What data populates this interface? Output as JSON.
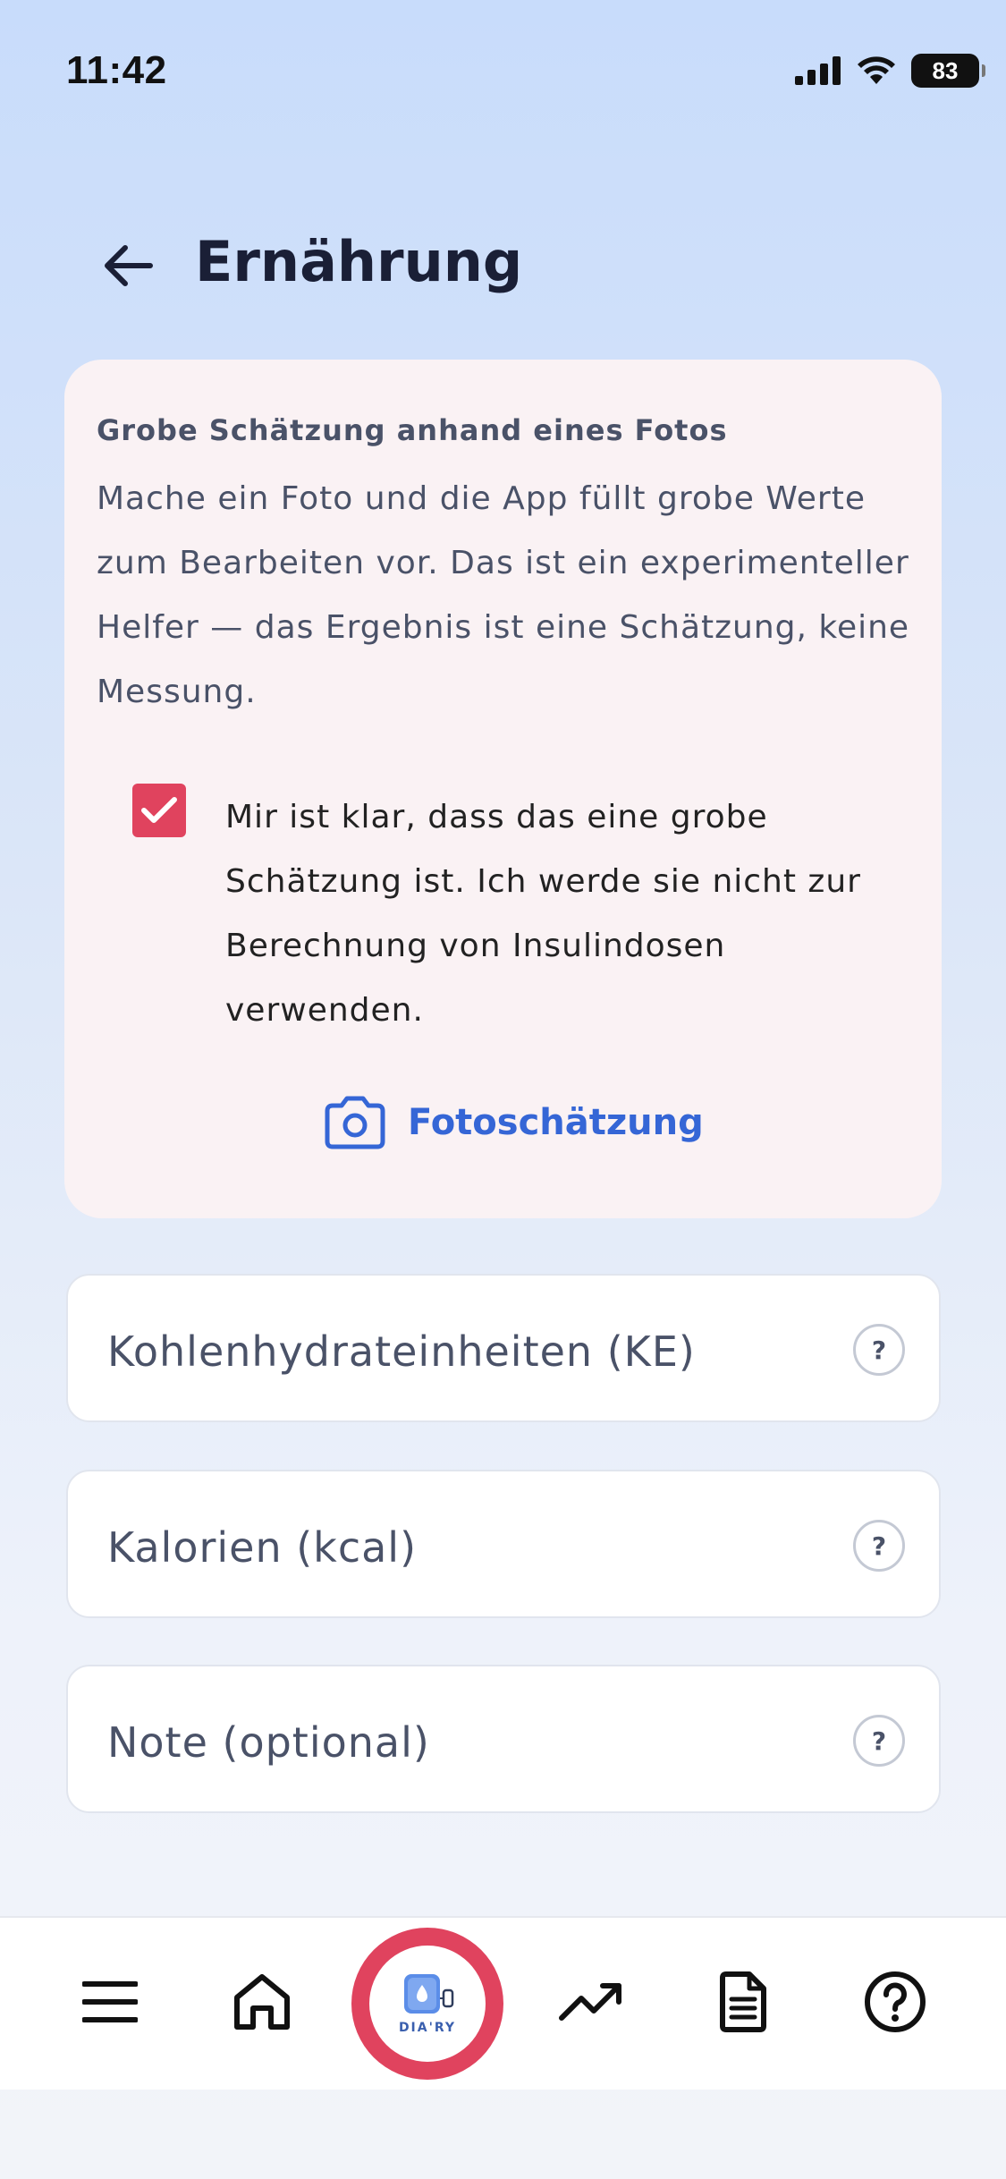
{
  "status_bar": {
    "time": "11:42",
    "battery": "83"
  },
  "header": {
    "title": "Ernährung",
    "back_icon": "arrow-left-icon"
  },
  "photo_card": {
    "title": "Grobe Schätzung anhand eines Fotos",
    "description": "Mache ein Foto und die App füllt grobe Werte zum Bearbeiten vor. Das ist ein experimenteller Helfer — das Ergebnis ist eine Schätzung, keine Messung.",
    "consent_checked": true,
    "consent_text": "Mir ist klar, dass das eine grobe Schätzung ist. Ich werde sie nicht zur Berechnung von Insulindosen verwenden.",
    "photo_button_label": "Fotoschätzung",
    "photo_button_icon": "camera-icon"
  },
  "fields": [
    {
      "label": "Kohlenhydrateinheiten (KE)",
      "help": "?"
    },
    {
      "label": "Kalorien (kcal)",
      "help": "?"
    },
    {
      "label": "Note (optional)",
      "help": "?"
    }
  ],
  "bottom_nav": {
    "items": [
      "menu-icon",
      "home-icon",
      "diary-logo",
      "trend-icon",
      "document-icon",
      "help-icon"
    ],
    "logo_text": "DIA'RY"
  },
  "colors": {
    "accent_red": "#e0435e",
    "link_blue": "#3566d6",
    "card_bg": "#faf2f4"
  }
}
